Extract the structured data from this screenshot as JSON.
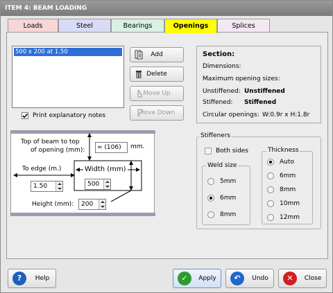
{
  "window": {
    "title": "ITEM 4: BEAM LOADING"
  },
  "tabs": [
    {
      "label": "Loads",
      "color": "#f8d6d6"
    },
    {
      "label": "Steel",
      "color": "#d7dbf6"
    },
    {
      "label": "Bearings",
      "color": "#d8f1e3"
    },
    {
      "label": "Openings",
      "color": "#ffff00"
    },
    {
      "label": "Splices",
      "color": "#f4e6f3"
    }
  ],
  "openings_list": {
    "items": [
      "500 x 200 at 1.50"
    ]
  },
  "buttons": {
    "add": "Add",
    "delete": "Delete",
    "move_up": "Move Up",
    "move_down": "Move Down"
  },
  "print_notes": {
    "label": "Print explanatory notes",
    "checked": true
  },
  "section_info": {
    "heading": "Section:",
    "dimensions_label": "Dimensions:",
    "max_opening_label": "Maximum opening sizes:",
    "unstiffened_label": "Unstiffened:",
    "unstiffened_value": "Unstiffened",
    "stiffened_label": "Stiffened:",
    "stiffened_value": "Stiffened",
    "circular_label": "Circular openings:",
    "circular_value": "W:0.9r x H:1.8r"
  },
  "diagram": {
    "top_label_1": "Top of beam to  top",
    "top_label_2": "of opening (mm):",
    "top_value": "= (106)",
    "top_unit": "mm.",
    "to_edge_label": "To edge (m.)",
    "to_edge_value": "1.50",
    "width_label": "Width (mm)",
    "width_value": "500",
    "height_label": "Height (mm):",
    "height_value": "200"
  },
  "stiffeners": {
    "title": "Stiffeners",
    "both_sides_label": "Both sides",
    "weld_title": "Weld size",
    "weld_options": [
      "5mm",
      "6mm",
      "8mm"
    ],
    "weld_selected": "6mm",
    "thickness_title": "Thickness",
    "thickness_options": [
      "Auto",
      "6mm",
      "8mm",
      "10mm",
      "12mm"
    ],
    "thickness_selected": "Auto"
  },
  "footer": {
    "help": "Help",
    "apply": "Apply",
    "undo": "Undo",
    "close": "Close"
  },
  "colors": {
    "selection": "#2d6fd6",
    "active_tab": "#ffff00"
  }
}
